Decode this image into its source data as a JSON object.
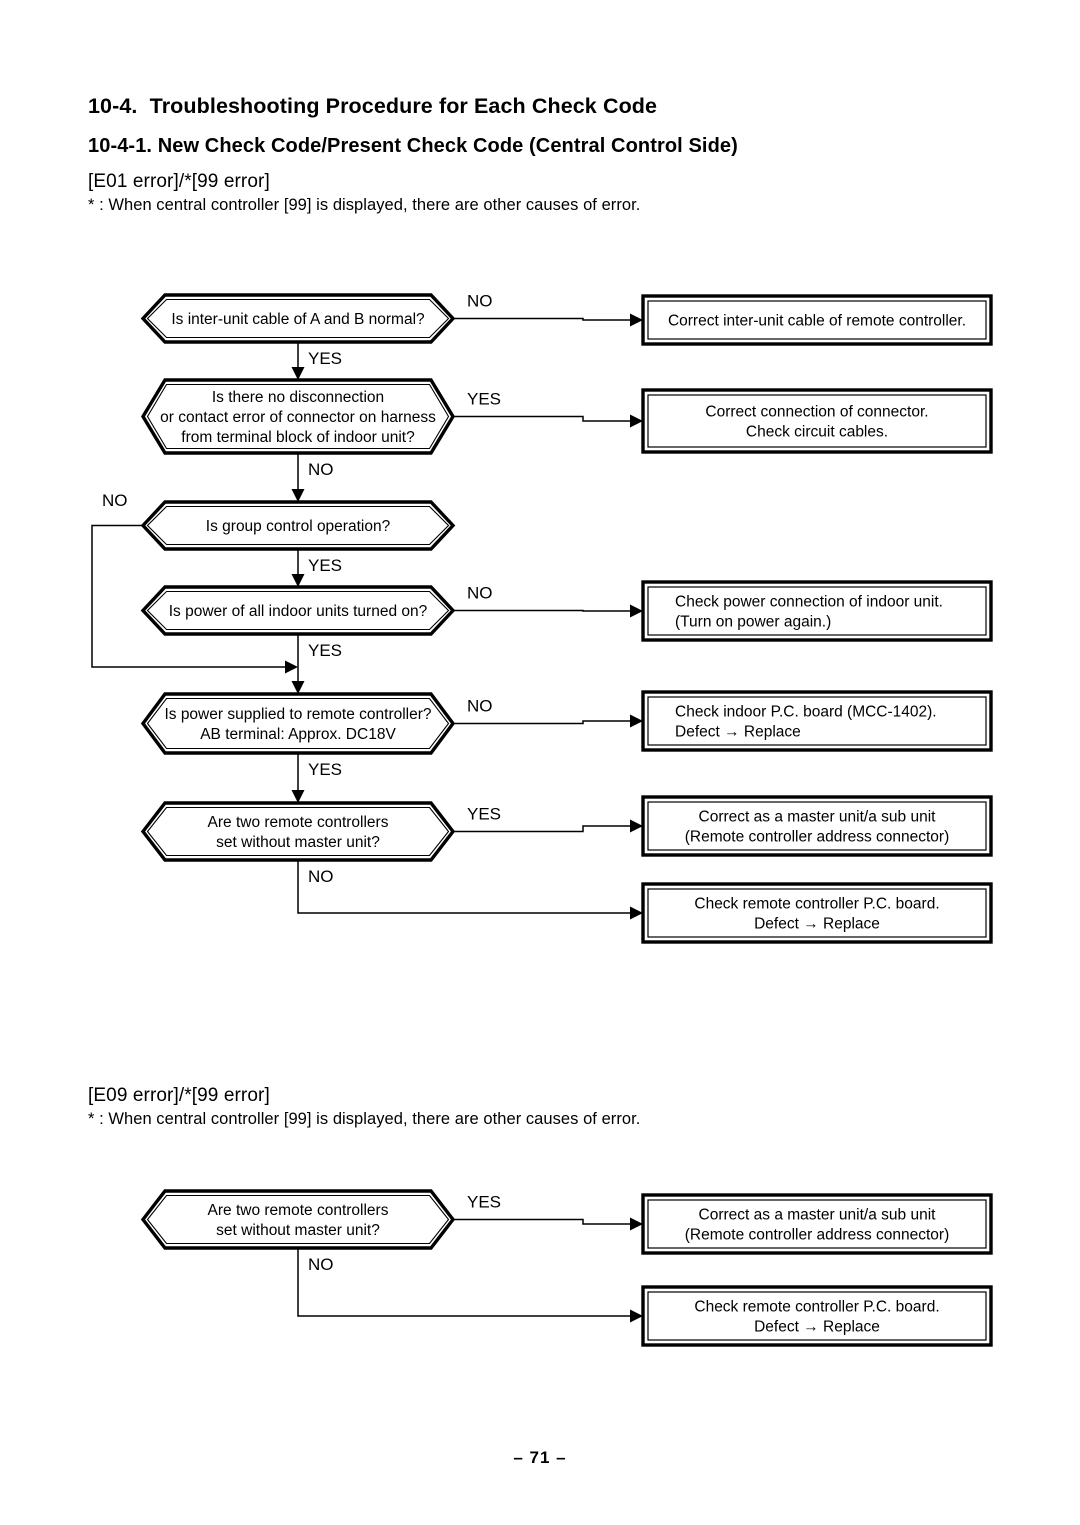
{
  "document": {
    "section_number_title": "10-4.  Troubleshooting Procedure for Each Check Code",
    "subsection_title": "10-4-1. New Check Code/Present Check Code (Central Control Side)",
    "page_number": "– 71 –"
  },
  "blocks": [
    {
      "id": "e01",
      "error_title": "[E01 error]/*[99 error]",
      "note": "* : When central controller [99] is displayed, there are other causes of error.",
      "decisions": [
        {
          "id": "d1",
          "lines": [
            "Is inter-unit cable of A and B normal?"
          ],
          "branch_side_label": "NO",
          "branch_down_label": "YES"
        },
        {
          "id": "d2",
          "lines": [
            "Is there no disconnection",
            "or contact error of connector on harness",
            "from terminal block of indoor unit?"
          ],
          "branch_side_label": "YES",
          "branch_down_label": "NO"
        },
        {
          "id": "d3",
          "lines": [
            "Is group control operation?"
          ],
          "branch_side_label": "NO",
          "branch_down_label": "YES"
        },
        {
          "id": "d4",
          "lines": [
            "Is power of all indoor units turned on?"
          ],
          "branch_side_label": "NO",
          "branch_down_label": "YES"
        },
        {
          "id": "d5",
          "lines": [
            "Is power supplied to remote controller?",
            "AB terminal: Approx. DC18V"
          ],
          "branch_side_label": "NO",
          "branch_down_label": "YES"
        },
        {
          "id": "d6",
          "lines": [
            "Are two remote controllers",
            "set without master unit?"
          ],
          "branch_side_label": "YES",
          "branch_down_label": "NO"
        }
      ],
      "actions": [
        {
          "id": "a1",
          "lines": [
            "Correct inter-unit cable of remote controller."
          ],
          "align": "center"
        },
        {
          "id": "a2",
          "lines": [
            "Correct connection of connector.",
            "Check circuit cables."
          ],
          "align": "center"
        },
        {
          "id": "a3",
          "lines": [
            "Check power connection of indoor unit.",
            "(Turn on power again.)"
          ],
          "align": "left"
        },
        {
          "id": "a4",
          "lines": [
            "Check indoor P.C. board (MCC-1402).",
            "Defect → Replace"
          ],
          "align": "left"
        },
        {
          "id": "a5",
          "lines": [
            "Correct as a master unit/a sub unit",
            "(Remote controller address connector)"
          ],
          "align": "center"
        },
        {
          "id": "a6",
          "lines": [
            "Check remote controller P.C. board.",
            "Defect → Replace"
          ],
          "align": "center"
        }
      ]
    },
    {
      "id": "e09",
      "error_title": "[E09 error]/*[99 error]",
      "note": "* : When central controller [99] is displayed, there are other causes of error.",
      "decisions": [
        {
          "id": "d1",
          "lines": [
            "Are two remote controllers",
            "set without master unit?"
          ],
          "branch_side_label": "YES",
          "branch_down_label": "NO"
        }
      ],
      "actions": [
        {
          "id": "a1",
          "lines": [
            "Correct as a master unit/a sub unit",
            "(Remote controller address connector)"
          ],
          "align": "center"
        },
        {
          "id": "a2",
          "lines": [
            "Check remote controller P.C. board.",
            "Defect → Replace"
          ],
          "align": "center"
        }
      ]
    }
  ]
}
